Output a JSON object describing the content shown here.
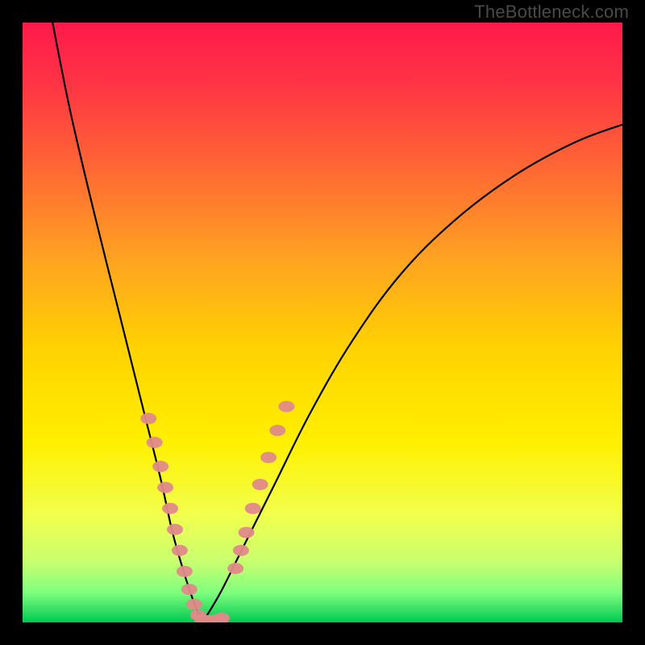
{
  "watermark": "TheBottleneck.com",
  "chart_data": {
    "type": "line",
    "title": "",
    "xlabel": "",
    "ylabel": "",
    "xlim": [
      0,
      100
    ],
    "ylim": [
      0,
      100
    ],
    "grid": false,
    "legend": false,
    "background_gradient_stops": [
      {
        "offset": 0.0,
        "color": "#ff1a4b"
      },
      {
        "offset": 0.1,
        "color": "#ff3345"
      },
      {
        "offset": 0.25,
        "color": "#ff6a33"
      },
      {
        "offset": 0.4,
        "color": "#ffa520"
      },
      {
        "offset": 0.55,
        "color": "#ffd400"
      },
      {
        "offset": 0.7,
        "color": "#fff000"
      },
      {
        "offset": 0.82,
        "color": "#f2ff4d"
      },
      {
        "offset": 0.9,
        "color": "#c8ff70"
      },
      {
        "offset": 0.95,
        "color": "#7fff7f"
      },
      {
        "offset": 1.0,
        "color": "#00c851"
      }
    ],
    "series": [
      {
        "name": "left-branch",
        "color": "#000000",
        "x": [
          5,
          8,
          12,
          16,
          20,
          23,
          25,
          27,
          28.5,
          29.5,
          30
        ],
        "y": [
          100,
          85,
          68,
          52,
          36,
          24,
          15,
          8,
          3.5,
          1,
          0
        ]
      },
      {
        "name": "right-branch",
        "color": "#000000",
        "x": [
          30,
          33,
          37,
          42,
          48,
          55,
          63,
          72,
          82,
          92,
          100
        ],
        "y": [
          0,
          5,
          13,
          23,
          35,
          47,
          58,
          67,
          74.5,
          80,
          83
        ]
      }
    ],
    "highlight_points": {
      "color": "#e08a8a",
      "points": [
        {
          "x": 21.0,
          "y": 34
        },
        {
          "x": 22.0,
          "y": 30
        },
        {
          "x": 23.0,
          "y": 26
        },
        {
          "x": 23.8,
          "y": 22.5
        },
        {
          "x": 24.6,
          "y": 19
        },
        {
          "x": 25.4,
          "y": 15.5
        },
        {
          "x": 26.2,
          "y": 12
        },
        {
          "x": 27.0,
          "y": 8.5
        },
        {
          "x": 27.8,
          "y": 5.5
        },
        {
          "x": 28.6,
          "y": 3
        },
        {
          "x": 29.3,
          "y": 1.2
        },
        {
          "x": 30.0,
          "y": 0.4
        },
        {
          "x": 30.8,
          "y": 0.3
        },
        {
          "x": 31.6,
          "y": 0.3
        },
        {
          "x": 32.4,
          "y": 0.4
        },
        {
          "x": 33.2,
          "y": 0.7
        },
        {
          "x": 35.5,
          "y": 9
        },
        {
          "x": 36.4,
          "y": 12
        },
        {
          "x": 37.3,
          "y": 15
        },
        {
          "x": 38.4,
          "y": 19
        },
        {
          "x": 39.6,
          "y": 23
        },
        {
          "x": 41.0,
          "y": 27.5
        },
        {
          "x": 42.5,
          "y": 32
        },
        {
          "x": 44.0,
          "y": 36
        }
      ]
    }
  }
}
